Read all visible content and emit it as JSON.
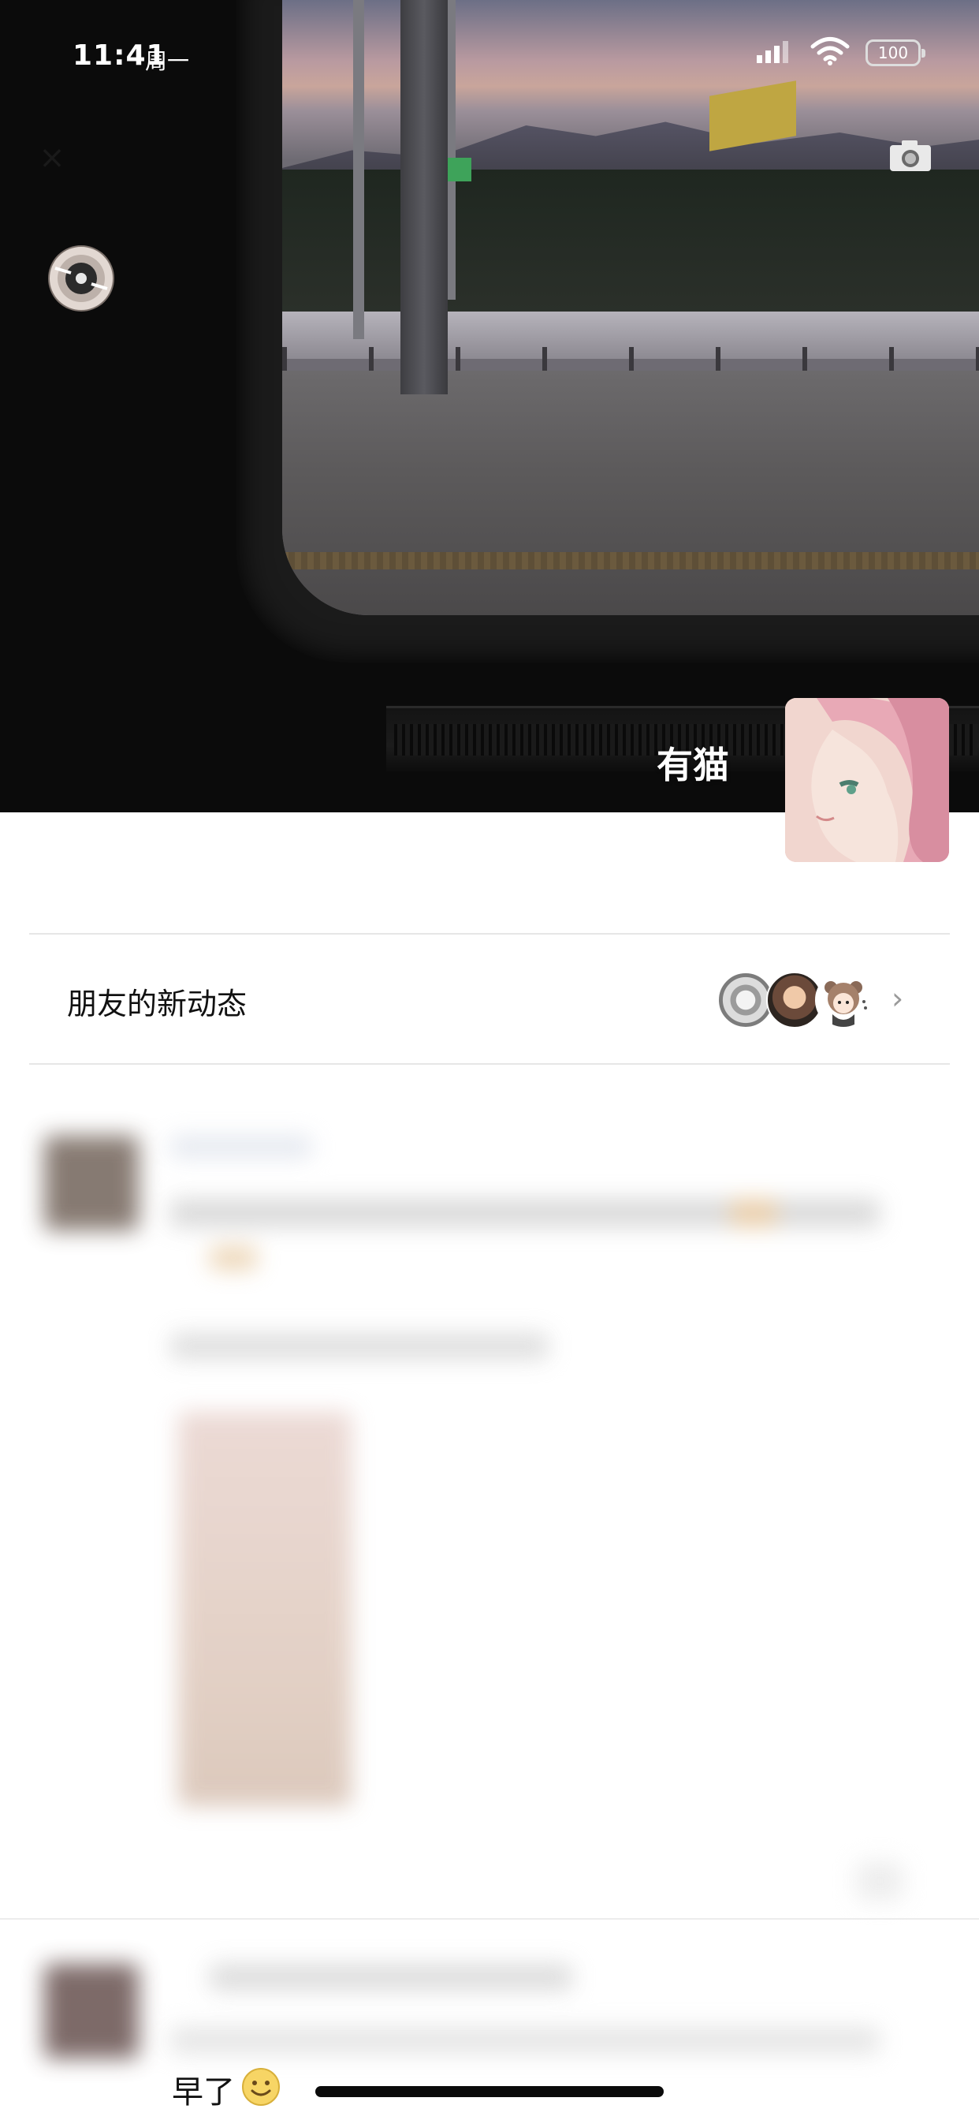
{
  "status_bar": {
    "time": "11:41",
    "day": "周一",
    "battery": "100",
    "icons": [
      "signal-icon",
      "wifi-icon",
      "battery-icon"
    ]
  },
  "header": {
    "close_icon": "close-icon",
    "camera_icon": "camera-icon",
    "music_icon": "music-disc-icon"
  },
  "profile": {
    "name": "有猫"
  },
  "updates": {
    "label": "朋友的新动态",
    "chevron": "›"
  },
  "feed": {
    "bottom_snippet": "早了"
  },
  "colors": {
    "background": "#ffffff",
    "cover_dark": "#0b0b0b",
    "divider": "#e6e6e6",
    "text_primary": "#111111",
    "chevron": "#9a9a9a"
  }
}
